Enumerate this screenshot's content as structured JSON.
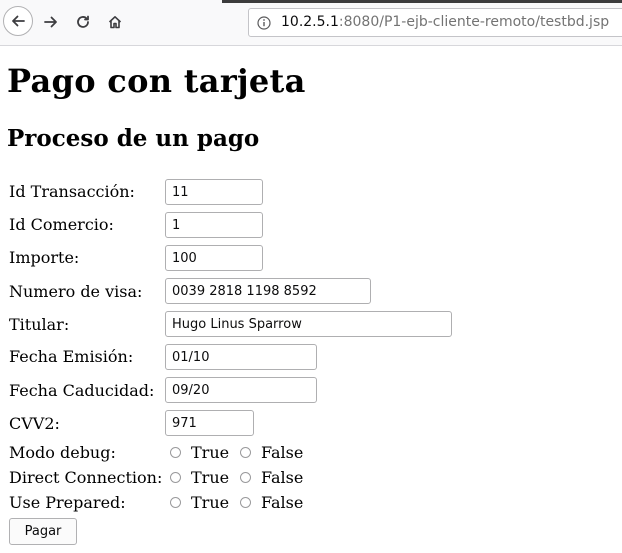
{
  "browser": {
    "url_host": "10.2.5.1",
    "url_path": ":8080/P1-ejb-cliente-remoto/testbd.jsp"
  },
  "page": {
    "title": "Pago con tarjeta",
    "subtitle": "Proceso de un pago"
  },
  "form": {
    "id_transaccion": {
      "label": "Id Transacción:",
      "value": "11"
    },
    "id_comercio": {
      "label": "Id Comercio:",
      "value": "1"
    },
    "importe": {
      "label": "Importe:",
      "value": "100"
    },
    "numero_visa": {
      "label": "Numero de visa:",
      "value": "0039 2818 1198 8592"
    },
    "titular": {
      "label": "Titular:",
      "value": "Hugo Linus Sparrow"
    },
    "fecha_emision": {
      "label": "Fecha Emisión:",
      "value": "01/10"
    },
    "fecha_caducidad": {
      "label": "Fecha Caducidad:",
      "value": "09/20"
    },
    "cvv2": {
      "label": "CVV2:",
      "value": "971"
    },
    "modo_debug": {
      "label": "Modo debug:",
      "true_label": "True",
      "false_label": "False"
    },
    "direct_connection": {
      "label": "Direct Connection:",
      "true_label": "True",
      "false_label": "False"
    },
    "use_prepared": {
      "label": "Use Prepared:",
      "true_label": "True",
      "false_label": "False"
    },
    "submit_label": "Pagar"
  }
}
